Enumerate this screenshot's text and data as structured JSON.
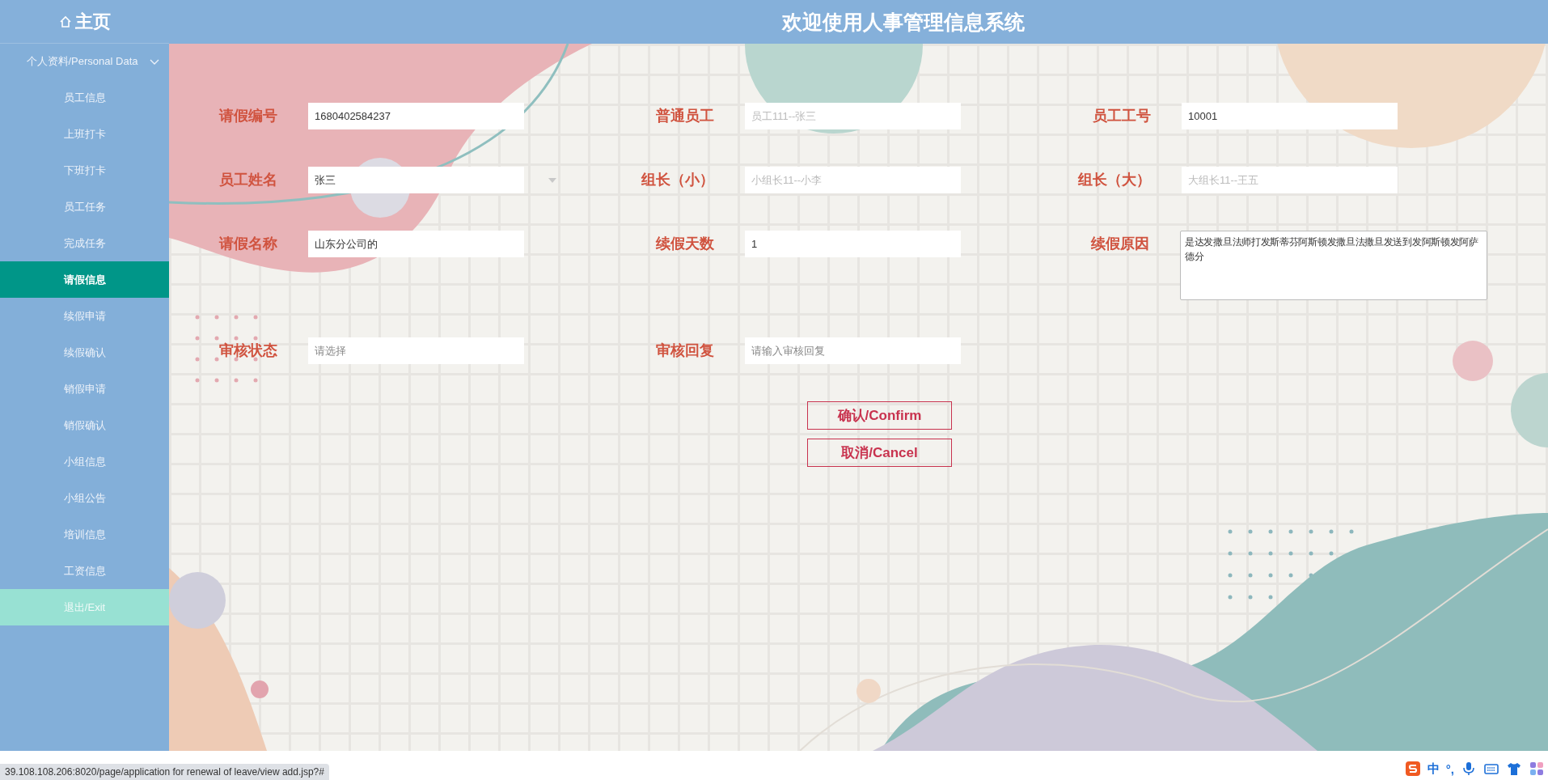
{
  "header": {
    "home_label": "主页",
    "title": "欢迎使用人事管理信息系统"
  },
  "sidebar": {
    "group": {
      "label": "个人资料/Personal Data",
      "expanded": true
    },
    "items": [
      {
        "label": "员工信息",
        "selected": false
      },
      {
        "label": "上班打卡",
        "selected": false
      },
      {
        "label": "下班打卡",
        "selected": false
      },
      {
        "label": "员工任务",
        "selected": false
      },
      {
        "label": "完成任务",
        "selected": false
      },
      {
        "label": "请假信息",
        "selected": true
      },
      {
        "label": "续假申请",
        "selected": false
      },
      {
        "label": "续假确认",
        "selected": false
      },
      {
        "label": "销假申请",
        "selected": false
      },
      {
        "label": "销假确认",
        "selected": false
      },
      {
        "label": "小组信息",
        "selected": false
      },
      {
        "label": "小组公告",
        "selected": false
      },
      {
        "label": "培训信息",
        "selected": false
      },
      {
        "label": "工资信息",
        "selected": false
      }
    ],
    "exit": {
      "label": "退出/Exit"
    }
  },
  "form": {
    "rows": [
      [
        {
          "label": "请假编号",
          "kind": "input",
          "value": "1680402584237"
        },
        {
          "label": "普通员工",
          "kind": "input",
          "placeholder": "员工111--张三"
        },
        {
          "label": "员工工号",
          "kind": "input",
          "value": "10001"
        }
      ],
      [
        {
          "label": "员工姓名",
          "kind": "select",
          "value": "张三"
        },
        {
          "label": "组长（小）",
          "kind": "input",
          "placeholder": "小组长11--小李"
        },
        {
          "label": "组长（大）",
          "kind": "input",
          "placeholder": "大组长11--王五"
        }
      ],
      [
        {
          "label": "请假名称",
          "kind": "input",
          "value": "山东分公司的"
        },
        {
          "label": "续假天数",
          "kind": "input",
          "value": "1"
        },
        {
          "label": "续假原因",
          "kind": "textarea",
          "value": "是达发撒旦法师打发斯蒂芬阿斯顿发撒旦法撒旦发送到发阿斯顿发阿萨德分"
        }
      ],
      [
        {
          "label": "审核状态",
          "kind": "input",
          "placeholder": "请选择"
        },
        {
          "label": "审核回复",
          "kind": "input",
          "placeholder": "请输入审核回复"
        }
      ]
    ],
    "buttons": [
      {
        "label": "确认/Confirm"
      },
      {
        "label": "取消/Cancel"
      }
    ]
  },
  "status_bar": {
    "url": "39.108.108.206:8020/page/application for renewal of leave/view add.jsp?#"
  },
  "ime": {
    "items": [
      "中",
      "°,"
    ]
  }
}
